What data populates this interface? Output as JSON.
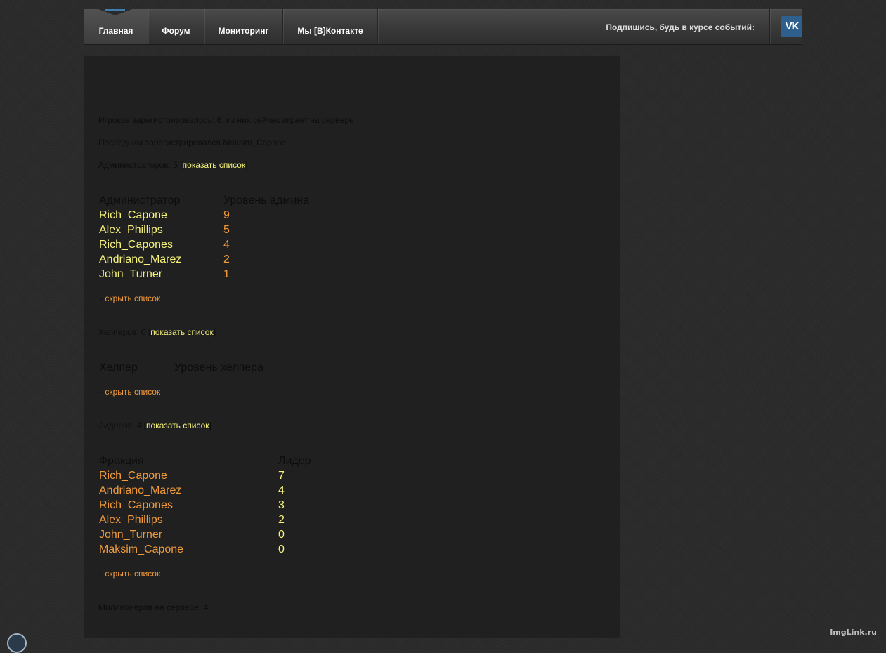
{
  "nav": {
    "items": [
      {
        "label": "Главная"
      },
      {
        "label": "Форум"
      },
      {
        "label": "Мониторинг"
      },
      {
        "label": "Мы [В]Контакте"
      }
    ],
    "subscribe_text": "Подпишись, будь в курсе событий:",
    "vk_label": "VK"
  },
  "stats": {
    "registered_text": "Игроков зарегистрировалось: 6, из них сейчас играет на сервере",
    "last_registered_text": "Последним зарегистрировался Maksim_Capone",
    "admins_label": "Администраторов: 5",
    "helpers_label": "Хелперов: 0",
    "leaders_label": "Лидеров: 4",
    "millionaires_text": "Миллионеров на сервере: 4",
    "show_list_label": "показать список",
    "hide_list_label": "скрыть список",
    "bracket_open": "[",
    "bracket_close": "]",
    "dash": "-"
  },
  "admins_table": {
    "headers": [
      "Администратор",
      "Уровень админа"
    ],
    "rows": [
      {
        "name": "Rich_Capone",
        "level": "9"
      },
      {
        "name": "Alex_Phillips",
        "level": "5"
      },
      {
        "name": "Rich_Capones",
        "level": "4"
      },
      {
        "name": "Andriano_Marez",
        "level": "2"
      },
      {
        "name": "John_Turner",
        "level": "1"
      }
    ]
  },
  "helpers_table": {
    "headers": [
      "Хелпер",
      "Уровень хелпера"
    ]
  },
  "leaders_table": {
    "headers": [
      "Фракция",
      "Лидер"
    ],
    "rows": [
      {
        "name": "Rich_Capone",
        "value": "7"
      },
      {
        "name": "Andriano_Marez",
        "value": "4"
      },
      {
        "name": "Rich_Capones",
        "value": "3"
      },
      {
        "name": "Alex_Phillips",
        "value": "2"
      },
      {
        "name": "John_Turner",
        "value": "0"
      },
      {
        "name": "Maksim_Capone",
        "value": "0"
      }
    ]
  },
  "watermark": "ImgLink.ru",
  "colors": {
    "link_yellow": "#f6f27a",
    "link_orange": "#f09a3c",
    "panel": "#202020",
    "vk_blue": "#2f5f8c"
  }
}
